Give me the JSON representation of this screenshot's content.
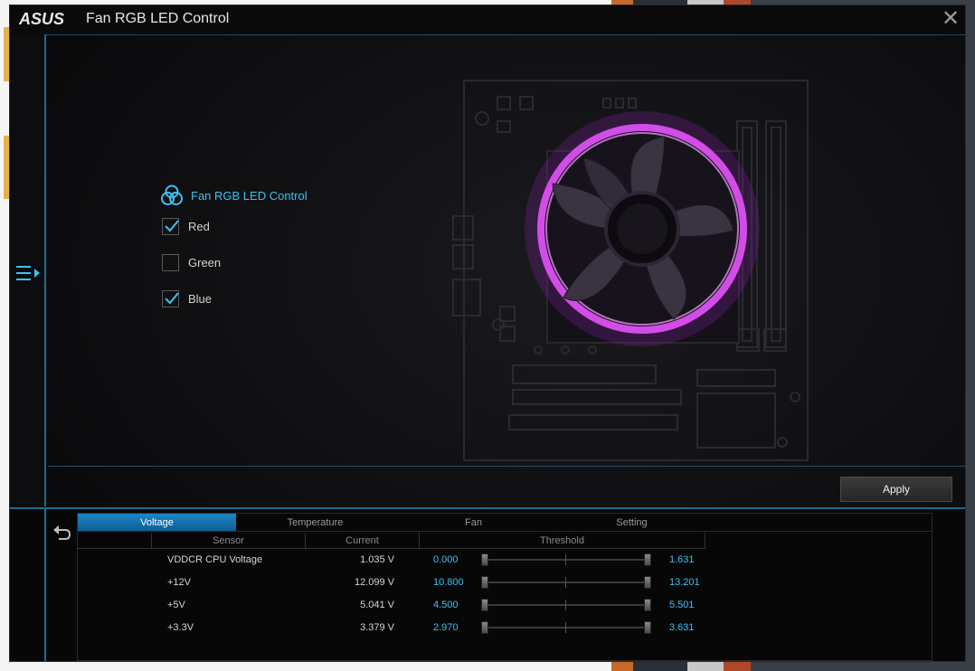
{
  "window": {
    "title": "Fan RGB LED Control",
    "brand": "ASUS",
    "close_glyph": "✕"
  },
  "panel": {
    "section_title": "Fan RGB LED Control",
    "options": [
      {
        "label": "Red",
        "checked": true
      },
      {
        "label": "Green",
        "checked": false
      },
      {
        "label": "Blue",
        "checked": true
      }
    ],
    "apply_label": "Apply",
    "led_color": "#e24cf0",
    "accent": "#3ec2f0"
  },
  "monitor": {
    "tabs": [
      "Voltage",
      "Temperature",
      "Fan",
      "Setting"
    ],
    "active_tab": "Voltage",
    "columns": {
      "sensor": "Sensor",
      "current": "Current",
      "threshold": "Threshold"
    },
    "rows": [
      {
        "sensor": "VDDCR CPU Voltage",
        "current": "1.035 V",
        "low": "0.000",
        "high": "1.631"
      },
      {
        "sensor": "+12V",
        "current": "12.099 V",
        "low": "10.800",
        "high": "13.201"
      },
      {
        "sensor": "+5V",
        "current": "5.041 V",
        "low": "4.500",
        "high": "5.501"
      },
      {
        "sensor": "+3.3V",
        "current": "3.379 V",
        "low": "2.970",
        "high": "3.631"
      }
    ]
  },
  "icons": {
    "menu": "menu-expand-icon",
    "back": "back-arrow-icon",
    "rgb": "rgb-circles-icon",
    "check": "checkmark-icon",
    "close": "close-icon"
  }
}
